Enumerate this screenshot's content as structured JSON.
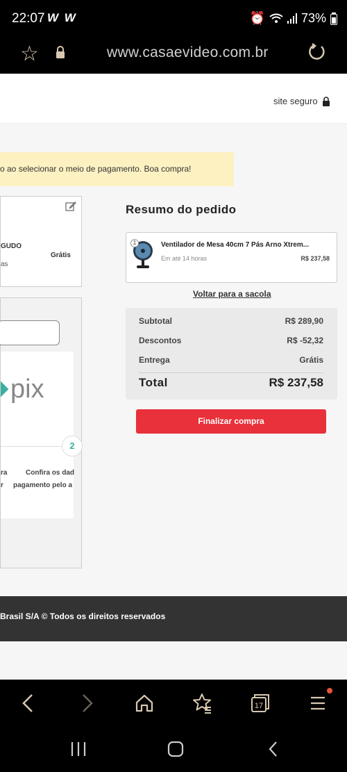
{
  "status_bar": {
    "time": "22:07",
    "notification_icons": "W W",
    "battery": "73%"
  },
  "url_bar": {
    "url": "www.casaevideo.com.br"
  },
  "header": {
    "secure_label": "site seguro"
  },
  "notice": {
    "text": "o ao selecionar o meio de pagamento. Boa compra!"
  },
  "shipping": {
    "method": "GUDO",
    "price": "Grátis",
    "sub": "as"
  },
  "payment": {
    "pix_logo_text": "pix",
    "step_number": "2",
    "step1_line1": "ra",
    "step1_line2": "r",
    "step2_line1": "Confira os dad",
    "step2_line2": "pagamento pelo a"
  },
  "summary": {
    "title": "Resumo do pedido",
    "product": {
      "qty": "1",
      "name": "Ventilador de Mesa 40cm 7 Pás Arno Xtrem...",
      "delivery": "Em até 14 horas",
      "price": "R$ 237,58"
    },
    "back_link": "Voltar para a sacola",
    "rows": {
      "subtotal_label": "Subtotal",
      "subtotal_value": "R$ 289,90",
      "discount_label": "Descontos",
      "discount_value": "R$ -52,32",
      "delivery_label": "Entrega",
      "delivery_value": "Grátis"
    },
    "total_label": "Total",
    "total_value": "R$ 237,58",
    "checkout_label": "Finalizar compra"
  },
  "footer": {
    "text": "Brasil S/A © Todos os direitos reservados"
  },
  "bottom_bar": {
    "tabs_count": "17"
  },
  "colors": {
    "accent_red": "#e8313a",
    "notice_yellow": "#fdf1c2",
    "pix_teal": "#3aaea0"
  }
}
